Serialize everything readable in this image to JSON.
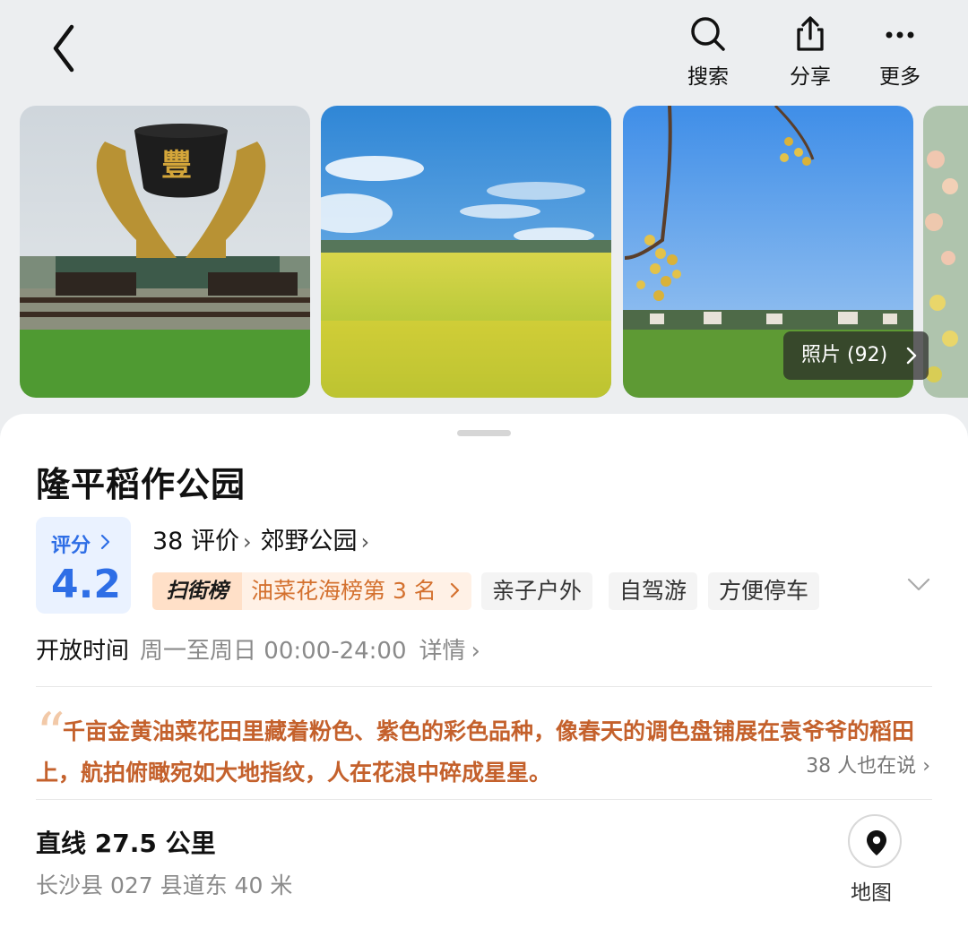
{
  "header": {
    "search_label": "搜索",
    "share_label": "分享",
    "more_label": "更多",
    "back_icon": "chevron-left-icon"
  },
  "gallery": {
    "photo_count": "照片 (92)",
    "sculpture_text": "豐"
  },
  "place": {
    "name": "隆平稻作公园",
    "rating_label": "评分",
    "rating_value": "4.2",
    "reviews": "38 评价",
    "category": "郊野公园",
    "rank_logo": "扫街榜",
    "rank_text": "油菜花海榜第 3 名",
    "tags": [
      "亲子户外",
      "自驾游",
      "方便停车"
    ],
    "hours_label": "开放时间",
    "hours_value": "周一至周日 00:00-24:00",
    "hours_detail": "详情",
    "quote": "千亩金黄油菜花田里藏着粉色、紫色的彩色品种，像春天的调色盘铺展在袁爷爷的稻田上，航拍俯瞰宛如大地指纹，人在花浪中碎成星星。",
    "quote_more": "38 人也在说",
    "distance": "直线 27.5 公里",
    "address": "长沙县 027 县道东 40 米",
    "map_label": "地图"
  },
  "colors": {
    "accent_blue": "#2e6ee6",
    "rank_orange": "#d4712f",
    "quote_brown": "#c4612c"
  }
}
